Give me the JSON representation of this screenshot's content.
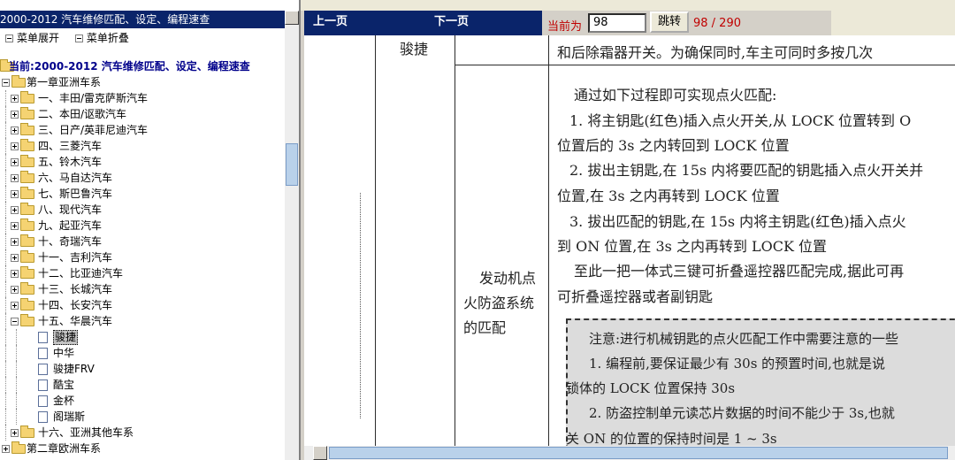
{
  "left_panel": {
    "title": "2000-2012 汽车维修匹配、设定、编程速查",
    "expand_all": "菜单展开",
    "collapse_all": "菜单折叠",
    "current_label": "当前:2000-2012 汽车维修匹配、设定、编程速查",
    "chapter1": "第一章亚洲车系",
    "chapter2": "第二章欧洲车系",
    "sections": [
      "一、丰田/雷克萨斯汽车",
      "二、本田/讴歌汽车",
      "三、日产/英菲尼迪汽车",
      "四、三菱汽车",
      "五、铃木汽车",
      "六、马自达汽车",
      "七、斯巴鲁汽车",
      "八、现代汽车",
      "九、起亚汽车",
      "十、奇瑞汽车",
      "十一、吉利汽车",
      "十二、比亚迪汽车",
      "十三、长城汽车",
      "十四、长安汽车",
      "十五、华晨汽车"
    ],
    "section15_items": [
      "骏捷",
      "中华",
      "骏捷FRV",
      "酷宝",
      "金杯",
      "阁瑞斯"
    ],
    "section16": "十六、亚洲其他车系"
  },
  "toolbar": {
    "prev_page": "上一页",
    "next_page": "下一页",
    "current_label": "当前为",
    "page_value": "98",
    "jump_button": "跳转",
    "page_count": "98 / 290"
  },
  "document": {
    "model_cell": "骏捷",
    "top_text": "和后除霜器开关。为确保同时,车主可同时多按几次",
    "row_label": [
      "发动机点",
      "火防盗系统",
      "的匹配"
    ],
    "lines": [
      "通过如下过程即可实现点火匹配:",
      "1. 将主钥匙(红色)插入点火开关,从 LOCK 位置转到 O",
      "位置后的 3s 之内转回到 LOCK 位置",
      "2. 拔出主钥匙,在 15s 内将要匹配的钥匙插入点火开关并",
      "位置,在 3s 之内再转到 LOCK 位置",
      "3. 拔出匹配的钥匙,在 15s 内将主钥匙(红色)插入点火",
      "到 ON 位置,在 3s 之内再转到 LOCK 位置",
      "至此一把一体式三键可折叠遥控器匹配完成,据此可再",
      "可折叠遥控器或者副钥匙"
    ],
    "note_lines": [
      "注意:进行机械钥匙的点火匹配工作中需要注意的一些",
      "1. 编程前,要保证最少有 30s 的预置时间,也就是说",
      "锁体的 LOCK 位置保持 30s",
      "2. 防盗控制单元读芯片数据的时间不能少于 3s,也就",
      "关 ON 的位置的保持时间是 1 ~ 3s"
    ]
  }
}
